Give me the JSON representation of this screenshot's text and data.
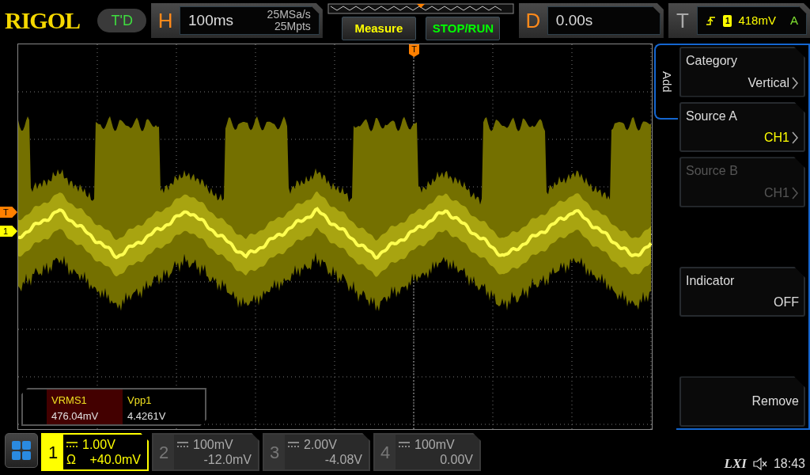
{
  "brand": "RIGOL",
  "mode_badge": "T'D",
  "horizontal": {
    "label": "H",
    "timebase": "100ms",
    "sample_rate": "25MSa/s",
    "memory_depth": "25Mpts"
  },
  "buttons": [
    {
      "label": "Measure",
      "kind": "measure"
    },
    {
      "label": "STOP/RUN",
      "kind": "run"
    }
  ],
  "delay": {
    "label": "D",
    "value": "0.00s"
  },
  "trigger": {
    "label": "T",
    "channel": "1",
    "level": "418mV",
    "mode": "A"
  },
  "screen": {
    "trigger_marker": "T",
    "left_markers": [
      {
        "label": "T",
        "color": "#ff8000"
      },
      {
        "label": "1",
        "color": "#ffff00"
      }
    ]
  },
  "measurements": [
    {
      "name": "VRMS1",
      "value": "476.04mV",
      "highlighted": true
    },
    {
      "name": "Vpp1",
      "value": "4.4261V",
      "highlighted": false
    }
  ],
  "menu": {
    "tab": "Add",
    "items": [
      {
        "kind": "submenu",
        "label": "Category",
        "value": "Vertical",
        "disabled": false
      },
      {
        "kind": "submenu",
        "label": "Source A",
        "value": "CH1",
        "color": "#ffff00",
        "disabled": false
      },
      {
        "kind": "submenu",
        "label": "Source B",
        "value": "CH1",
        "disabled": true
      },
      {
        "kind": "blank"
      },
      {
        "kind": "toggle",
        "label": "Indicator",
        "value": "OFF",
        "disabled": false
      },
      {
        "kind": "blank"
      },
      {
        "kind": "action",
        "value": "Remove",
        "disabled": false
      }
    ]
  },
  "channels": [
    {
      "number": "1",
      "scale": "1.00V",
      "offset": "+40.0mV",
      "impedance": "Ω",
      "active": true
    },
    {
      "number": "2",
      "scale": "100mV",
      "offset": "-12.0mV",
      "active": false
    },
    {
      "number": "3",
      "scale": "2.00V",
      "offset": "-4.08V",
      "active": false
    },
    {
      "number": "4",
      "scale": "100mV",
      "offset": "0.00V",
      "active": false
    }
  ],
  "status": {
    "lxi": "LXI",
    "time": "18:43"
  }
}
